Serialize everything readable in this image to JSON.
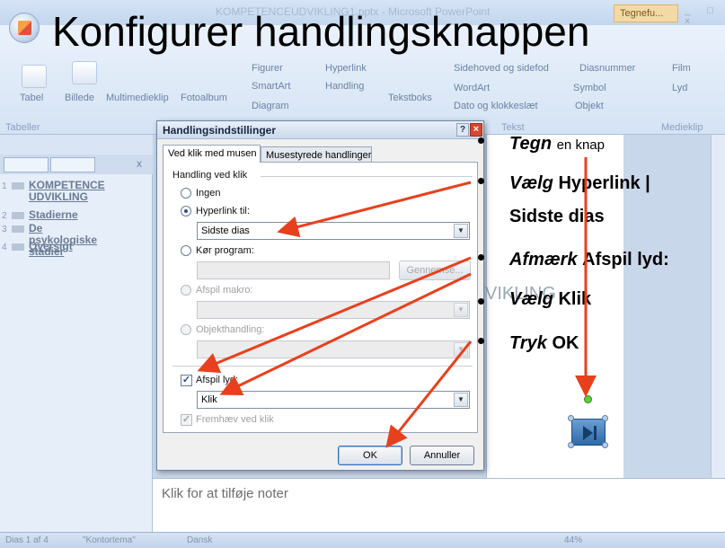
{
  "slide_title": "Konfigurer handlingsknappen",
  "window": {
    "doc_title": "KOMPETENCEUDVIKLING1.pptx - Microsoft PowerPoint",
    "context_tab": "Tegnefu...",
    "controls": "_ □ ×"
  },
  "ribbon": {
    "items": {
      "tabel": "Tabel",
      "billede": "Billede",
      "multimedieklip": "Multimedieklip",
      "fotoalbum": "Fotoalbum",
      "figurer": "Figurer",
      "smartart": "SmartArt",
      "diagram": "Diagram",
      "hyperlink": "Hyperlink",
      "handling": "Handling",
      "tekstboks": "Tekstboks",
      "sidehoved": "Sidehoved og sidefod",
      "wordart": "WordArt",
      "dato": "Dato og klokkeslæt",
      "diasnummer": "Diasnummer",
      "symbol": "Symbol",
      "objekt": "Objekt",
      "film": "Film",
      "lyd": "Lyd"
    },
    "groups": {
      "tabeller": "Tabeller",
      "tekst": "Tekst",
      "medieklip": "Medieklip"
    }
  },
  "outline": {
    "items": [
      {
        "num": "1",
        "lines": [
          "KOMPETENCE",
          "UDVIKLING"
        ]
      },
      {
        "num": "2",
        "lines": [
          "Stadierne"
        ]
      },
      {
        "num": "3",
        "lines": [
          "De",
          "psykologiske",
          "stadier"
        ]
      },
      {
        "num": "4",
        "lines": [
          "Oversigt"
        ]
      }
    ]
  },
  "dialog": {
    "title": "Handlingsindstillinger",
    "help": "?",
    "close": "×",
    "tabs": [
      "Ved klik med musen",
      "Musestyrede handlinger"
    ],
    "group_label": "Handling ved klik",
    "options": {
      "ingen": "Ingen",
      "hyperlink": "Hyperlink til:",
      "hyperlink_value": "Sidste dias",
      "program": "Kør program:",
      "gennemse": "Gennemse...",
      "makro": "Afspil makro:",
      "objekt": "Objekthandling:",
      "afspil_lyd": "Afspil lyd:",
      "lyd_value": "Klik",
      "fremhaev": "Fremhæv ved klik"
    },
    "ok": "OK",
    "cancel": "Annuller"
  },
  "bullets": [
    {
      "it": "Tegn",
      "rest": "",
      "small": "en knap"
    },
    {
      "it": "Vælg",
      "rest": "Hyperlink |",
      "small": ""
    },
    {
      "it": "",
      "rest": "Sidste dias",
      "small": ""
    },
    {
      "it": "Afmærk",
      "rest": "Afspil lyd:",
      "small": ""
    },
    {
      "it": "Vælg",
      "rest": "Klik",
      "small": ""
    },
    {
      "it": "Tryk",
      "rest": "OK",
      "small": ""
    }
  ],
  "slide_partial_text": "VIKLING",
  "notes_placeholder": "Klik for at tilføje noter",
  "status": {
    "slide": "Dias 1 af 4",
    "theme": "\"Kontortema\"",
    "language": "Dansk",
    "zoom": "44%"
  },
  "colors": {
    "arrow": "#e8401c",
    "title": "#000000",
    "dialog_close": "#d5472e"
  }
}
